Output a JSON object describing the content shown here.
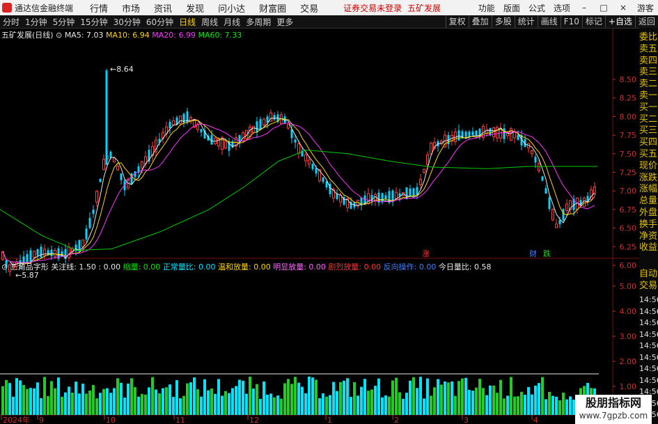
{
  "app": {
    "title": "通达信金融终端",
    "alert": "证券交易未登录",
    "stock_name": "五矿发展"
  },
  "menu": [
    "行情",
    "市场",
    "资讯",
    "发现",
    "问小达",
    "财富圈",
    "交易"
  ],
  "topright": [
    "功能",
    "版面",
    "公式",
    "选项",
    "游客"
  ],
  "periods": [
    {
      "label": "分时",
      "active": false
    },
    {
      "label": "1分钟",
      "active": false
    },
    {
      "label": "5分钟",
      "active": false
    },
    {
      "label": "15分钟",
      "active": false
    },
    {
      "label": "30分钟",
      "active": false
    },
    {
      "label": "60分钟",
      "active": false
    },
    {
      "label": "日线",
      "active": true
    },
    {
      "label": "周线",
      "active": false
    },
    {
      "label": "月线",
      "active": false
    },
    {
      "label": "多周期",
      "active": false
    },
    {
      "label": "更多",
      "active": false
    }
  ],
  "right_buttons": [
    "复权",
    "叠加",
    "多股",
    "统计",
    "画线",
    "F10",
    "标记",
    "+自选",
    "返回"
  ],
  "ma": {
    "title": "五矿发展(日线)",
    "ma5": "MA5: 7.03",
    "ma10": "MA10: 6.94",
    "ma20": "MA20: 6.99",
    "ma60": "MA60: 7.33"
  },
  "indicator": {
    "name": "三角品字形",
    "focus": "关注线: 1.50 : 0.00",
    "suoliang": "缩量: 0.00",
    "normal": "正常量比: 0.00",
    "mild": "温和放量: 0.00",
    "obvious": "明显放量: 0.00",
    "sharp": "剧烈放量: 0.00",
    "reverse": "反向操作: 0.00",
    "today": "今日量比: 0.58"
  },
  "annotations": {
    "high": "8.64",
    "low": "5.87",
    "zhang": "涨",
    "cai": "财",
    "die": "跌"
  },
  "side_labels": [
    "委比",
    "卖五",
    "卖四",
    "卖三",
    "卖二",
    "卖一",
    "买一",
    "买二",
    "买三",
    "买四",
    "买五",
    "现价",
    "涨跌",
    "涨幅",
    "总量",
    "外盘",
    "换手",
    "净资",
    "收益"
  ],
  "side_labels2": [
    "自动",
    "交易"
  ],
  "side_times": [
    "14:56",
    "14:56",
    "14:56",
    "14:56",
    "14:56",
    "14:56",
    "14:56",
    "14:56",
    "14:56",
    "14:56",
    "14:56"
  ],
  "price_ticks": [
    "8.50",
    "8.25",
    "8.00",
    "7.75",
    "7.50",
    "7.25",
    "7.00",
    "6.75",
    "6.50",
    "6.25",
    "6.00"
  ],
  "vol_ticks": [
    "5.00",
    "4.00",
    "3.00",
    "2.00",
    "1.00"
  ],
  "x_labels": [
    "2024年",
    "9",
    "10",
    "11",
    "12",
    "1",
    "2",
    "3",
    "4"
  ],
  "watermark": {
    "line1": "股朋指标网",
    "line2": "www.7gpzb.com"
  },
  "colors": {
    "up": "#ff3c3c",
    "down": "#00d5ff",
    "ma5": "#e8e8e8",
    "ma10": "#ffd700",
    "ma20": "#ff33ff",
    "ma60": "#00cc00"
  }
}
